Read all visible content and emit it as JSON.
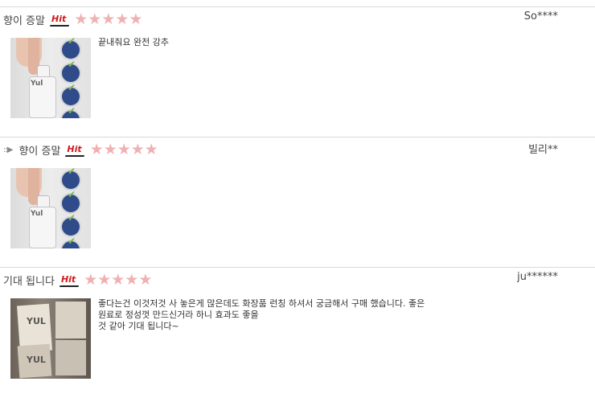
{
  "reviews": [
    {
      "title": "향이 증말",
      "badge": "Hit",
      "rating_stars": "★★★★★",
      "rating_value": 5,
      "user": "So****",
      "text_lines": [
        "끝내줘요 완전 강추"
      ],
      "photo": "serum-bottle-photo"
    },
    {
      "title": "향이 증말",
      "badge": "Hit",
      "rating_stars": "★★★★★",
      "rating_value": 5,
      "user": "빌리**",
      "text_lines": [],
      "photo": "serum-bottle-photo",
      "expand_icon": "::▶"
    },
    {
      "title": "기대 됩니다",
      "badge": "Hit",
      "rating_stars": "★★★★★",
      "rating_value": 5,
      "user": "ju******",
      "text_lines": [
        "좋다는건 이것저것 사 놓은게 많은데도 화장품 런칭 하셔서 궁금해서 구매 했습니다. 좋은",
        "원료로 정성껏 만드신거라 하니 효과도 좋을",
        "것 같아 기대 됩니다~"
      ],
      "photo": "cream-tubes-photo"
    }
  ],
  "photo_labels": {
    "serum_bottle": "Yul",
    "tube": "YUL"
  },
  "colors": {
    "stars": "#efb1b1",
    "hit_badge": "#d21a1a",
    "divider": "#d9d9d9"
  }
}
